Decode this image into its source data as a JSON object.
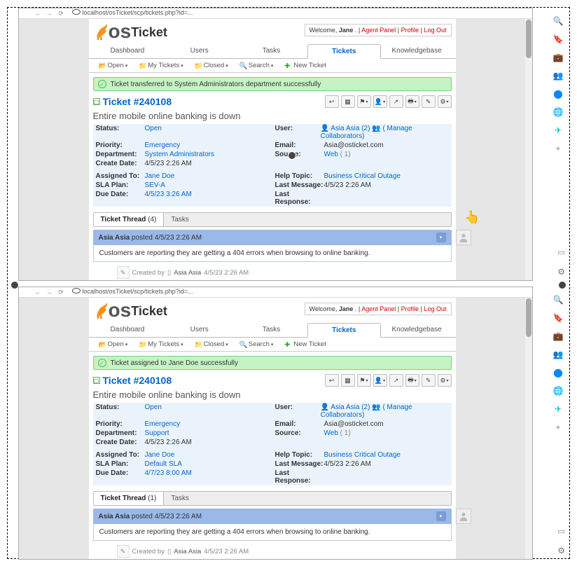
{
  "rside_icons": [
    "magnify-icon",
    "tag-icon",
    "briefcase-icon",
    "people-icon",
    "circle-icon",
    "globe-icon",
    "send-icon",
    "plus-icon"
  ],
  "rside_bottom": [
    "panel-icon",
    "gear-icon"
  ],
  "browser_url": "localhost/osTicket/scp/tickets.php?id=...",
  "common": {
    "welcome_pre": "Welcome, ",
    "welcome_user": "Jane",
    "welcome_sep": " . | ",
    "agent_panel": "Agent Panel",
    "profile": "Profile",
    "logout": "Log Out",
    "tabs": [
      "Dashboard",
      "Users",
      "Tasks",
      "Tickets",
      "Knowledgebase"
    ],
    "subtabs": {
      "open": "Open",
      "my": "My Tickets",
      "closed": "Closed",
      "search": "Search",
      "new": "New Ticket"
    },
    "ticket_prefix": "Ticket #",
    "ticket_num": "240108",
    "subject": "Entire mobile online banking is down",
    "labels": {
      "status": "Status:",
      "priority": "Priority:",
      "dept": "Department:",
      "create": "Create Date:",
      "user": "User:",
      "email": "Email:",
      "source": "Source:",
      "assigned": "Assigned To:",
      "sla": "SLA Plan:",
      "due": "Due Date:",
      "topic": "Help Topic:",
      "lastmsg": "Last Message:",
      "lastresp": "Last Response:"
    },
    "status": "Open",
    "priority": "Emergency",
    "create": "4/5/23 2:26 AM",
    "user_name": "Asia Asia",
    "user_count": "(2)",
    "collab": "( Manage Collaborators)",
    "email": "Asia@osticket.com",
    "source": "Web",
    "source_n": "(   1)",
    "assigned": "Jane Doe",
    "topic": "Business Critical Outage",
    "lastmsg": "4/5/23 2:26 AM",
    "thread_tab": "Ticket Thread",
    "tasks_tab": "Tasks",
    "post_user": "Asia Asia",
    "post_verb": " posted ",
    "post_time": "4/5/23 2:26 AM",
    "post_body": "Customers are reporting they are getting a 404 errors when browsing to online banking.",
    "created_by": "Created by ",
    "created_user": "Asia Asia",
    "created_time": " 4/5/23 2:26 AM"
  },
  "top": {
    "flash": "Ticket transferred to System Administrators department successfully",
    "dept": "System Administrators",
    "sla": "SEV-A",
    "due": "4/5/23 3:26 AM",
    "thread_count": "(4)"
  },
  "bot": {
    "flash": "Ticket assigned to Jane Doe successfully",
    "dept": "Support",
    "sla": "Default SLA",
    "due": "4/7/23 8:00 AM",
    "thread_count": "(1)"
  }
}
